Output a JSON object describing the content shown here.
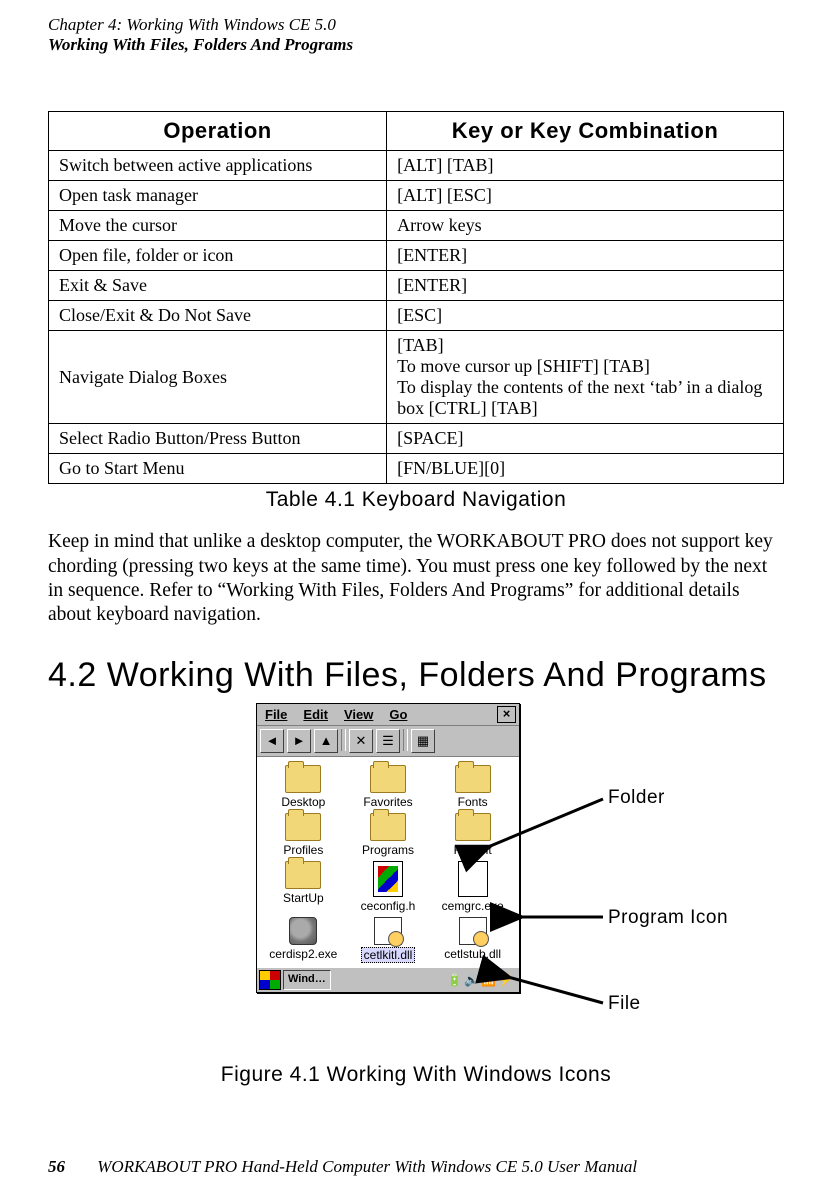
{
  "header": {
    "chapter_line": "Chapter 4: Working With Windows CE 5.0",
    "section_line": "Working With Files, Folders And Programs"
  },
  "table": {
    "header_op": "Operation",
    "header_key": "Key or Key Combination",
    "rows": [
      {
        "op": "Switch between active applications",
        "key": "[ALT] [TAB]"
      },
      {
        "op": "Open task manager",
        "key": "[ALT] [ESC]"
      },
      {
        "op": "Move the cursor",
        "key": "Arrow keys"
      },
      {
        "op": "Open file, folder or icon",
        "key": "[ENTER]"
      },
      {
        "op": "Exit & Save",
        "key": "[ENTER]"
      },
      {
        "op": "Close/Exit & Do Not Save",
        "key": "[ESC]"
      },
      {
        "op": "Navigate Dialog Boxes",
        "key": "[TAB]\nTo move cursor up [SHIFT] [TAB]\nTo display the contents of the next ‘tab’ in a dialog box [CTRL] [TAB]"
      },
      {
        "op": "Select Radio Button/Press Button",
        "key": "[SPACE]"
      },
      {
        "op": "Go to Start Menu",
        "key": "[FN/BLUE][0]"
      }
    ],
    "caption": "Table 4.1   Keyboard Navigation"
  },
  "paragraph": "Keep in mind that unlike a desktop computer, the WORKABOUT PRO does not support key chording (pressing two keys at the same time). You must press one key followed by the next in sequence. Refer to “Working With Files, Folders And Programs” for additional details about keyboard navigation.",
  "section_heading": "4.2  Working With Files, Folders And Programs",
  "figure": {
    "menus": {
      "file": "File",
      "edit": "Edit",
      "view": "View",
      "go": "Go",
      "close": "×"
    },
    "items": [
      {
        "label": "Desktop",
        "type": "folder"
      },
      {
        "label": "Favorites",
        "type": "folder"
      },
      {
        "label": "Fonts",
        "type": "folder"
      },
      {
        "label": "Profiles",
        "type": "folder"
      },
      {
        "label": "Programs",
        "type": "folder"
      },
      {
        "label": "Recent",
        "type": "folder"
      },
      {
        "label": "StartUp",
        "type": "folder"
      },
      {
        "label": "ceconfig.h",
        "type": "progfile"
      },
      {
        "label": "cemgrc.exe",
        "type": "progicon"
      },
      {
        "label": "cerdisp2.exe",
        "type": "exe"
      },
      {
        "label": "cetlkitl.dll",
        "type": "dll",
        "selected": true
      },
      {
        "label": "cetlstub.dll",
        "type": "dll"
      }
    ],
    "taskbar_button": "Wind…",
    "callouts": {
      "folder": "Folder",
      "program": "Program Icon",
      "file": "File"
    },
    "caption": "Figure 4.1 Working With Windows Icons"
  },
  "footer": {
    "page_number": "56",
    "text": "WORKABOUT PRO Hand-Held Computer With Windows CE 5.0 User Manual"
  }
}
